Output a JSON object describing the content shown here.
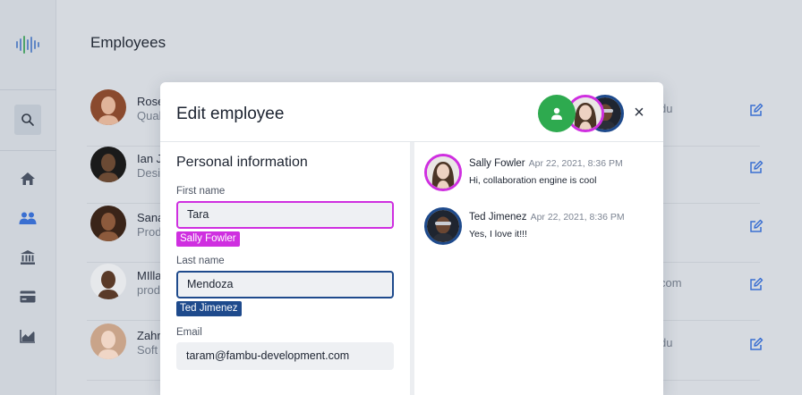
{
  "page": {
    "title": "Employees"
  },
  "sidebar": {
    "icons": [
      "logo-icon",
      "search-icon",
      "home-icon",
      "users-icon",
      "bank-icon",
      "card-icon",
      "chart-icon"
    ],
    "active": "users-icon",
    "accent": "#3a6fd1"
  },
  "employees": [
    {
      "name": "Rose",
      "role": "Qual",
      "email": "du",
      "avatar_colors": [
        "#8a4a2e",
        "#e0b49a"
      ]
    },
    {
      "name": "Ian J",
      "role": "Desi",
      "email": "",
      "avatar_colors": [
        "#1a1a1a",
        "#6b4a34"
      ]
    },
    {
      "name": "Sana",
      "role": "Prod",
      "email": "",
      "avatar_colors": [
        "#3a2418",
        "#8c5a3c"
      ]
    },
    {
      "name": "MIlla",
      "role": "prod",
      "email": "com",
      "avatar_colors": [
        "#e6e8eb",
        "#5a3a28"
      ]
    },
    {
      "name": "Zahr",
      "role": "Soft",
      "email": "du",
      "avatar_colors": [
        "#c9a48a",
        "#f0d6c6"
      ]
    }
  ],
  "modal": {
    "title": "Edit employee",
    "close_label": "×",
    "presence": [
      {
        "name": "me",
        "color": "#2eaa4f",
        "icon": "user-icon"
      },
      {
        "name": "Sally Fowler",
        "color": "#cf2fe0"
      },
      {
        "name": "Ted Jimenez",
        "color": "#1e4a8c"
      }
    ],
    "form": {
      "section_title": "Personal information",
      "first_name": {
        "label": "First name",
        "value": "Tara",
        "editor": "Sally Fowler",
        "editor_color": "#cf2fe0"
      },
      "last_name": {
        "label": "Last name",
        "value": "Mendoza",
        "editor": "Ted Jimenez",
        "editor_color": "#1e4a8c"
      },
      "email": {
        "label": "Email",
        "value": "taram@fambu-development.com"
      }
    },
    "chat": [
      {
        "author": "Sally Fowler",
        "time": "Apr 22, 2021, 8:36 PM",
        "text": "Hi, collaboration engine is cool",
        "color": "#cf2fe0"
      },
      {
        "author": "Ted Jimenez",
        "time": "Apr 22, 2021, 8:36 PM",
        "text": "Yes, I love it!!!",
        "color": "#1e4a8c"
      }
    ]
  }
}
